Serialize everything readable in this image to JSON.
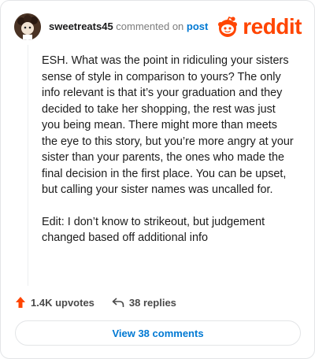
{
  "comment": {
    "username": "sweetreats45",
    "action_text": "commented on",
    "target_link": "post",
    "paragraphs": [
      "ESH. What was the point in ridiculing your sisters sense of style in comparison to yours? The only info relevant is that it’s your graduation and they decided to take her shopping, the rest was just you being mean. There might more than meets the eye to this story, but you’re more angry at your sister than your parents, the ones who made the final decision in the first place. You can be upset, but calling your sister names was uncalled for.",
      "Edit: I don’t know to strikeout, but judgement changed based off additional info"
    ]
  },
  "brand": {
    "wordmark": "reddit",
    "color": "#ff4500",
    "icon": "reddit-snoo-icon"
  },
  "stats": {
    "upvotes": "1.4K upvotes",
    "replies": "38 replies",
    "upvote_icon": "upvote-arrow-icon",
    "reply_icon": "reply-arrow-icon",
    "upvote_color": "#ff4500"
  },
  "footer": {
    "view_comments_label": "View 38 comments"
  },
  "colors": {
    "link": "#0079d3",
    "border": "#e3e5e7"
  }
}
